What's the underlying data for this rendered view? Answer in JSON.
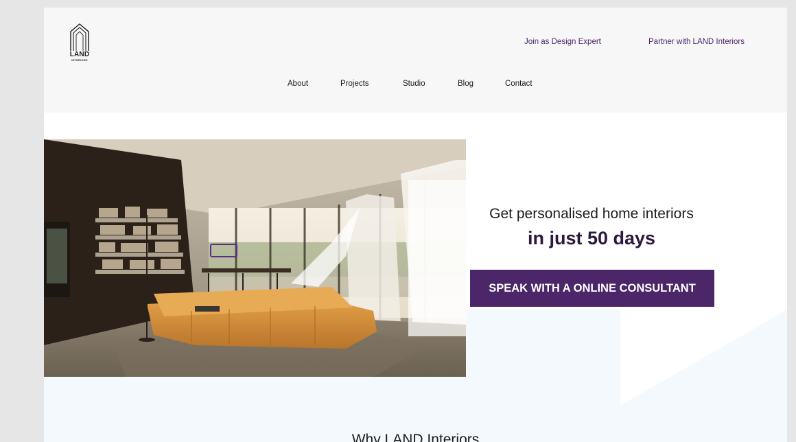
{
  "brand": {
    "logo_word": "LAND",
    "logo_sub": "INTERIORS",
    "name": "LAND Interiors"
  },
  "header": {
    "top_links": [
      "Join as Design Expert",
      "Partner with LAND Interiors"
    ],
    "nav": [
      "About",
      "Projects",
      "Studio",
      "Blog",
      "Contact"
    ]
  },
  "hero": {
    "image_alt": "Modern living room with orange sofa and lake view",
    "tagline": "Get personalised home interiors",
    "tagline_strong": "in just 50 days",
    "cta_label": "SPEAK WITH A ONLINE CONSULTANT"
  },
  "section": {
    "title": "Why LAND Interiors"
  },
  "colors": {
    "accent": "#4b2669",
    "header_bg": "#f7f7f7",
    "hero_bg": "#f4f9fd"
  }
}
